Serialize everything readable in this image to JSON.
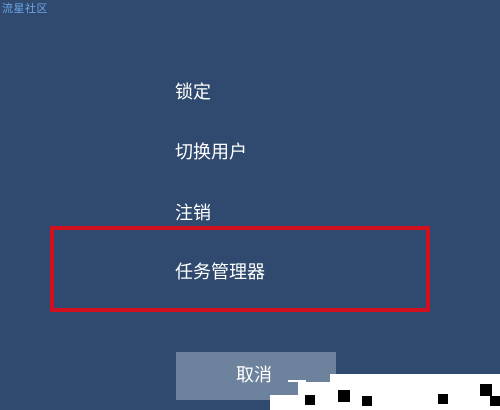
{
  "watermark": {
    "text": "流星社区"
  },
  "menu": {
    "items": [
      {
        "label": "锁定"
      },
      {
        "label": "切换用户"
      },
      {
        "label": "注销"
      },
      {
        "label": "任务管理器"
      }
    ]
  },
  "cancel": {
    "label": "取消"
  },
  "colors": {
    "background": "#2f4a6e",
    "highlight_border": "#d0101e",
    "cancel_button": "#6d829d"
  }
}
